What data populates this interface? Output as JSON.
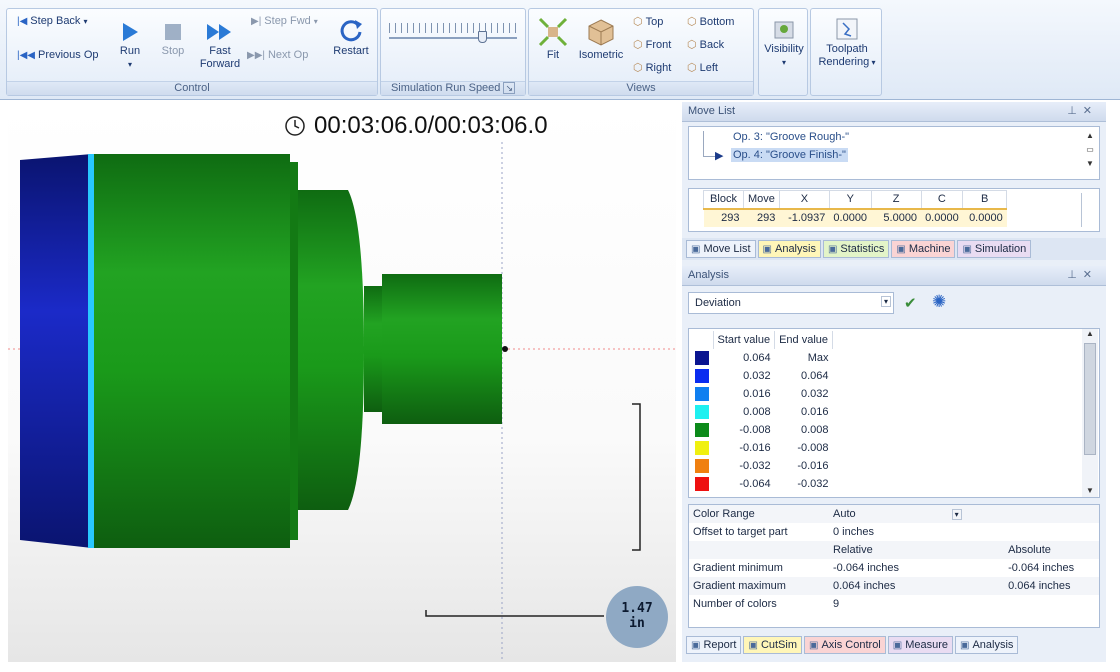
{
  "control": {
    "step_back": "Step Back",
    "previous_op": "Previous Op",
    "run": "Run",
    "stop": "Stop",
    "fast_forward_1": "Fast",
    "fast_forward_2": "Forward",
    "step_fwd": "Step Fwd",
    "next_op": "Next Op",
    "restart": "Restart",
    "group_label": "Control"
  },
  "speed": {
    "group_label": "Simulation Run Speed",
    "value": 0.75
  },
  "views": {
    "fit": "Fit",
    "isometric": "Isometric",
    "top": "Top",
    "front": "Front",
    "right": "Right",
    "bottom": "Bottom",
    "back": "Back",
    "left": "Left",
    "group_label": "Views"
  },
  "visibility": "Visibility",
  "toolpath_1": "Toolpath",
  "toolpath_2": "Rendering",
  "viewport": {
    "time": "00:03:06.0/00:03:06.0",
    "scale_value": "1.47",
    "scale_unit": "in"
  },
  "move_list": {
    "title": "Move List",
    "ops": [
      "Op. 3: \"Groove Rough-\"",
      "Op. 4: \"Groove Finish-\""
    ],
    "columns": [
      "Block",
      "Move",
      "X",
      "Y",
      "Z",
      "C",
      "B"
    ],
    "row": [
      "293",
      "293",
      "-1.0937",
      "0.0000",
      "5.0000",
      "0.0000",
      "0.0000"
    ]
  },
  "mid_tabs": [
    "Move List",
    "Analysis",
    "Statistics",
    "Machine",
    "Simulation"
  ],
  "analysis": {
    "title": "Analysis",
    "mode": "Deviation",
    "columns": [
      "Start value",
      "End value"
    ],
    "colors": [
      {
        "color": "#0a1490",
        "start": "0.064",
        "end": "Max"
      },
      {
        "color": "#0a2cf0",
        "start": "0.032",
        "end": "0.064"
      },
      {
        "color": "#0f7ff0",
        "start": "0.016",
        "end": "0.032"
      },
      {
        "color": "#1ef0f0",
        "start": "0.008",
        "end": "0.016"
      },
      {
        "color": "#0c8a1a",
        "start": "-0.008",
        "end": "0.008"
      },
      {
        "color": "#f0f010",
        "start": "-0.016",
        "end": "-0.008"
      },
      {
        "color": "#f08010",
        "start": "-0.032",
        "end": "-0.016"
      },
      {
        "color": "#ee1010",
        "start": "-0.064",
        "end": "-0.032"
      }
    ],
    "props": {
      "color_range_label": "Color Range",
      "color_range_value": "Auto",
      "offset_label": "Offset to target part",
      "offset_value": "0 inches",
      "relative_header": "Relative",
      "absolute_header": "Absolute",
      "gmin_label": "Gradient minimum",
      "gmin_rel": "-0.064 inches",
      "gmin_abs": "-0.064 inches",
      "gmax_label": "Gradient maximum",
      "gmax_rel": "0.064 inches",
      "gmax_abs": "0.064 inches",
      "ncolors_label": "Number of colors",
      "ncolors_value": "9"
    }
  },
  "bottom_tabs": [
    "Report",
    "CutSim",
    "Axis Control",
    "Measure",
    "Analysis"
  ]
}
